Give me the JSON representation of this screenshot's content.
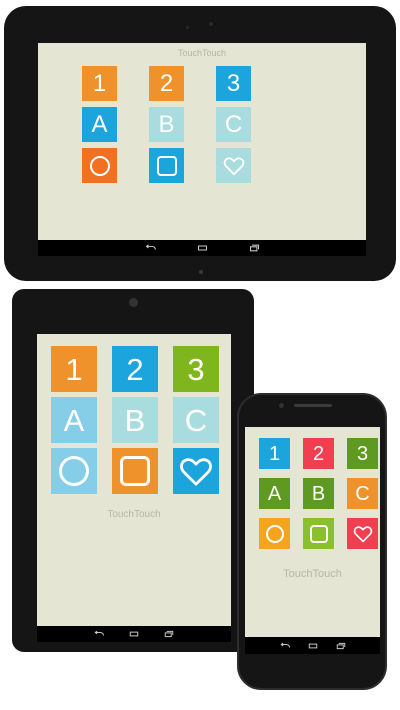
{
  "app_title": "TouchTouch",
  "colors": {
    "screen_bg": "#e4e5d3",
    "device_body": "#151515",
    "orange": "#f0922b",
    "orange_red": "#f27021",
    "blue": "#1ba5dc",
    "light_blue": "#86cde8",
    "pale_teal": "#a9dcde",
    "green": "#7fb61e",
    "dark_green": "#5e9a22",
    "red": "#ef3f50",
    "yellow_orange": "#f4a51d",
    "lime": "#8bc02d"
  },
  "nav_icons": [
    "back-icon",
    "home-icon",
    "recent-apps-icon"
  ],
  "devices": {
    "large_tablet": {
      "title": "TouchTouch",
      "rows": [
        [
          {
            "label": "1",
            "color": "#f0922b"
          },
          {
            "label": "2",
            "color": "#f0922b"
          },
          {
            "label": "3",
            "color": "#1ba5dc"
          }
        ],
        [
          {
            "label": "A",
            "color": "#1ba5dc"
          },
          {
            "label": "B",
            "color": "#a9dcde"
          },
          {
            "label": "C",
            "color": "#a9dcde"
          }
        ],
        [
          {
            "icon": "circle-icon",
            "color": "#f27021"
          },
          {
            "icon": "square-icon",
            "color": "#1ba5dc"
          },
          {
            "icon": "heart-icon",
            "color": "#a9dcde"
          }
        ]
      ]
    },
    "medium_tablet": {
      "title": "TouchTouch",
      "rows": [
        [
          {
            "label": "1",
            "color": "#f0922b"
          },
          {
            "label": "2",
            "color": "#1ba5dc"
          },
          {
            "label": "3",
            "color": "#7fb61e"
          }
        ],
        [
          {
            "label": "A",
            "color": "#86cde8"
          },
          {
            "label": "B",
            "color": "#a9dcde"
          },
          {
            "label": "C",
            "color": "#a9dcde"
          }
        ],
        [
          {
            "icon": "circle-icon",
            "color": "#86cde8"
          },
          {
            "icon": "square-icon",
            "color": "#f0922b"
          },
          {
            "icon": "heart-icon",
            "color": "#1ba5dc"
          }
        ]
      ]
    },
    "phone": {
      "title": "TouchTouch",
      "rows": [
        [
          {
            "label": "1",
            "color": "#1ba5dc"
          },
          {
            "label": "2",
            "color": "#ef3f50"
          },
          {
            "label": "3",
            "color": "#5e9a22"
          }
        ],
        [
          {
            "label": "A",
            "color": "#5e9a22"
          },
          {
            "label": "B",
            "color": "#5e9a22"
          },
          {
            "label": "C",
            "color": "#f0922b"
          }
        ],
        [
          {
            "icon": "circle-icon",
            "color": "#f4a51d"
          },
          {
            "icon": "square-icon",
            "color": "#8bc02d"
          },
          {
            "icon": "heart-icon",
            "color": "#ef3f50"
          }
        ]
      ]
    }
  }
}
